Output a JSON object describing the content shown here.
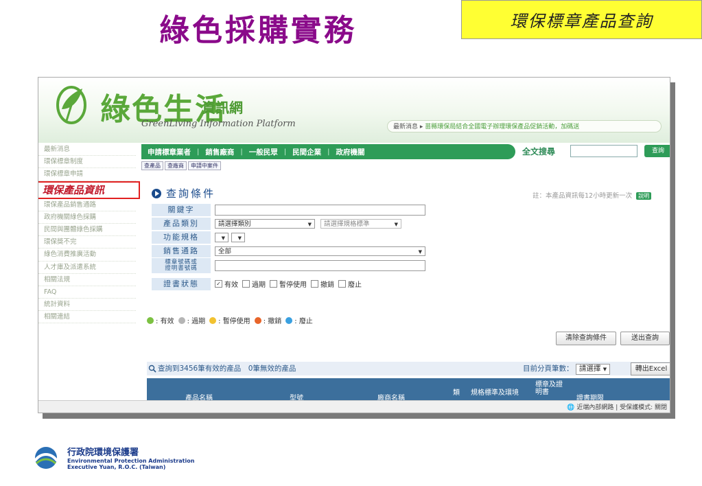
{
  "slide": {
    "title": "綠色採購實務",
    "corner_label": "環保標章產品查詢"
  },
  "site": {
    "logo_text": "綠色生活",
    "logo_subtitle": "資訊網",
    "logo_english": "GreenLiving Information Platform",
    "news_label": "最新消息 ▸",
    "news_text": "苗縣環保局結合全國電子辦理環保產品促銷活動，加碼送"
  },
  "sidebar": {
    "items": [
      {
        "label": "最新消息"
      },
      {
        "label": "環保標章制度"
      },
      {
        "label": "環保標章申請"
      },
      {
        "label": "環保產品資訊",
        "active": true
      },
      {
        "label": "環保產品銷售通路"
      },
      {
        "label": "政府機關綠色採購"
      },
      {
        "label": "民間與團體綠色採購"
      },
      {
        "label": "環保獎不完"
      },
      {
        "label": "綠色消費推廣活動"
      },
      {
        "label": "人才庫及派遣系統"
      },
      {
        "label": "相關法規"
      },
      {
        "label": "FAQ"
      },
      {
        "label": "統計資料"
      },
      {
        "label": "相關連結"
      }
    ]
  },
  "topnav": {
    "items": [
      "申請標章業者",
      "銷售廠商",
      "一般民眾",
      "民間企業",
      "政府機關"
    ],
    "fulltext_label": "全文搜尋",
    "search_button": "查詢"
  },
  "subtabs": [
    "查產品",
    "查廠商",
    "申請中案件"
  ],
  "query": {
    "title": "查詢條件",
    "note": "註：本產品資訊每12小時更新一次",
    "note_button": "說明",
    "fields": {
      "keyword_label": "關鍵字",
      "category_label": "產品類別",
      "category_value": "請選擇類別",
      "spec_placeholder": "請選擇規格標準",
      "function_label": "功能規格",
      "channel_label": "銷售通路",
      "channel_value": "全部",
      "cert_label_1": "標章號碼或",
      "cert_label_2": "證明書號碼",
      "status_label": "證書狀態"
    },
    "status_options": [
      {
        "label": "有效",
        "checked": true
      },
      {
        "label": "過期",
        "checked": false
      },
      {
        "label": "暫停使用",
        "checked": false
      },
      {
        "label": "撤銷",
        "checked": false
      },
      {
        "label": "廢止",
        "checked": false
      }
    ],
    "legend": [
      {
        "label": "有效",
        "color": "#7cc142"
      },
      {
        "label": "過期",
        "color": "#b5b5b5"
      },
      {
        "label": "暫停使用",
        "color": "#f2c230"
      },
      {
        "label": "撤銷",
        "color": "#e8652a"
      },
      {
        "label": "廢止",
        "color": "#3aa0e0"
      }
    ],
    "clear_button": "清除查詢條件",
    "submit_button": "送出查詢"
  },
  "results": {
    "summary": "查詢到3456筆有效的產品　0筆無效的產品",
    "page_size_label": "目前分頁筆數：",
    "page_size_value": "請選擇",
    "export_button": "轉出Excel",
    "headers": [
      "產品名稱",
      "型號",
      "廠商名稱",
      "類",
      "規格標準及環境",
      "標章及證明書",
      "證書期限"
    ]
  },
  "statusbar": {
    "text": "近端內部網路 | 受保護模式: 關閉"
  },
  "footer": {
    "agency_cn": "行政院環境保護署",
    "agency_en_1": "Environmental Protection Administration",
    "agency_en_2": "Executive Yuan, R.O.C. (Taiwan)"
  },
  "colors": {
    "title": "#8a0a8a",
    "corner_bg": "#ffff33",
    "nav_green": "#2e9c58",
    "highlight_border": "#e12020",
    "table_header": "#3c6f9c"
  }
}
